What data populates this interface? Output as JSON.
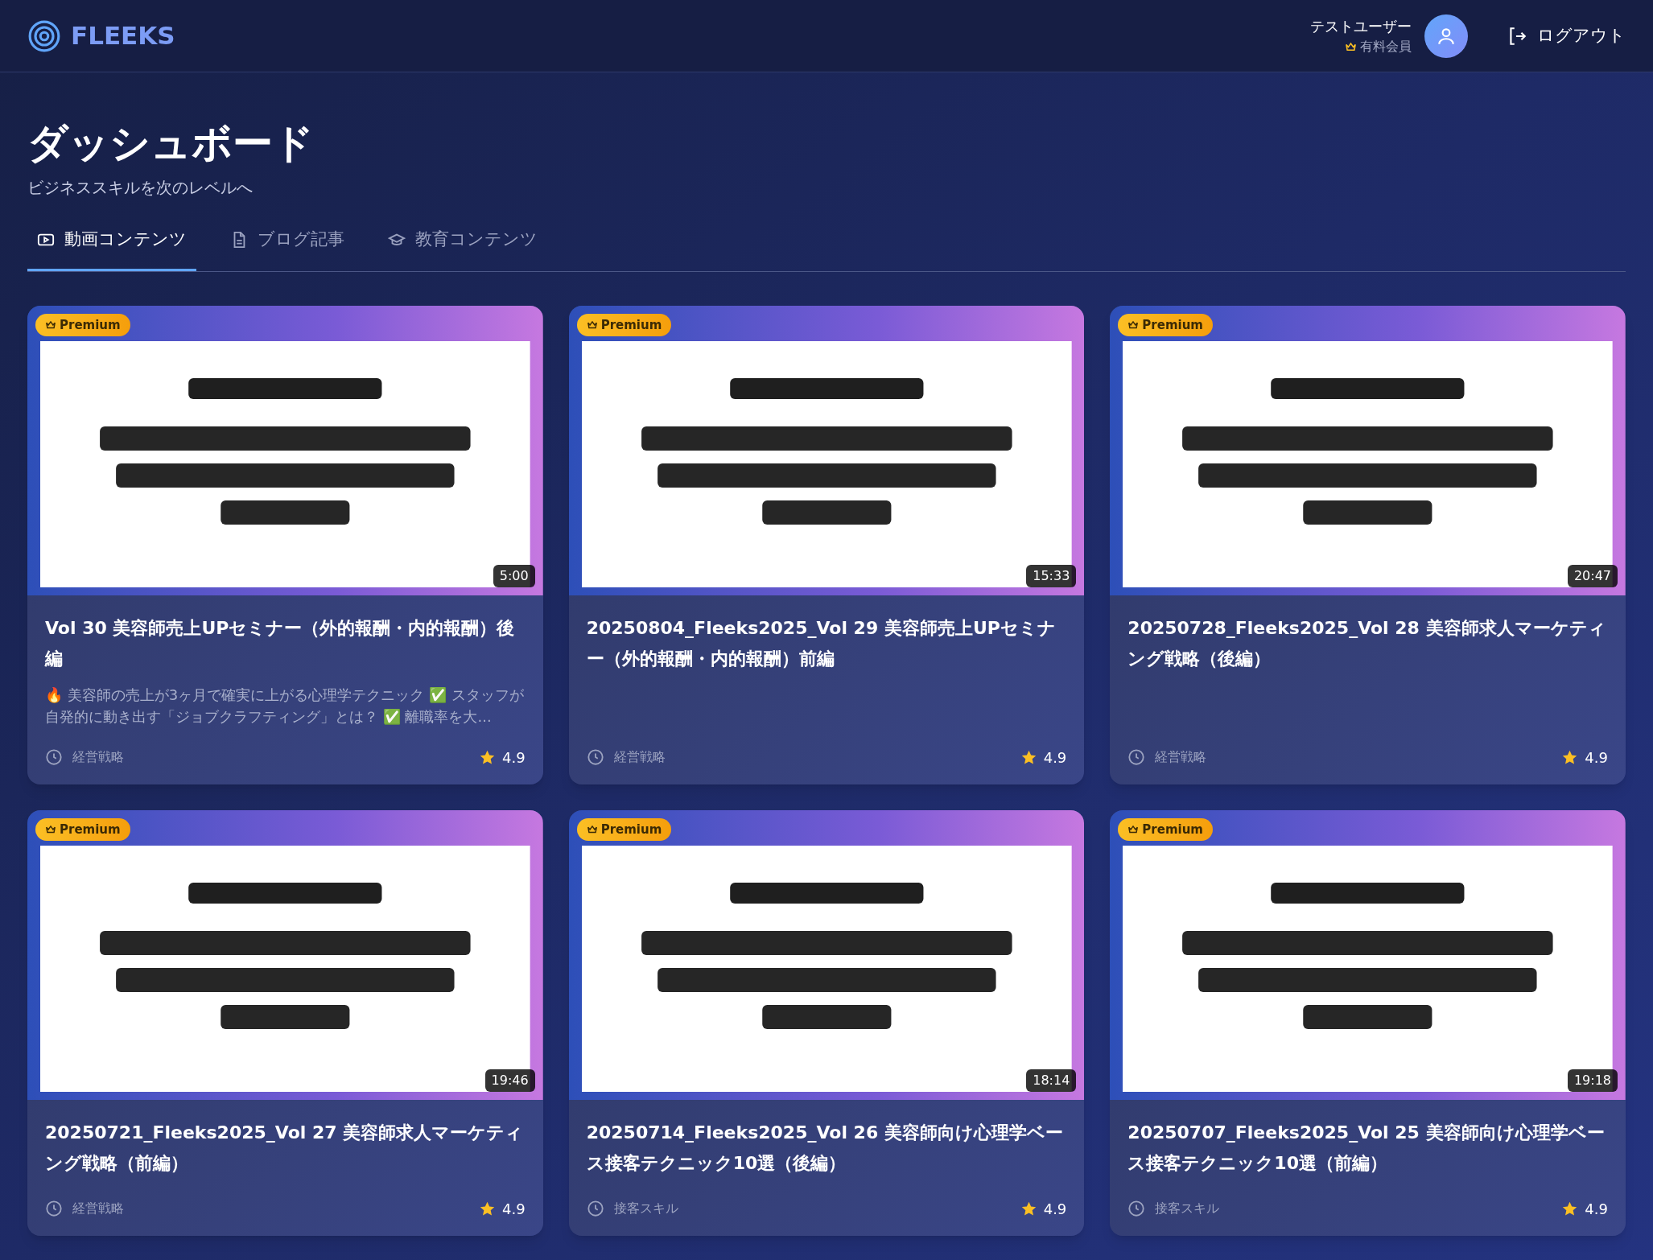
{
  "header": {
    "logo": "FLEEKS",
    "user": {
      "name": "テストユーザー",
      "membership": "有料会員"
    },
    "logout": "ログアウト"
  },
  "page": {
    "title": "ダッシュボード",
    "subtitle": "ビジネススキルを次のレベルへ"
  },
  "tabs": [
    {
      "label": "動画コンテンツ",
      "kind": "video",
      "selected": true
    },
    {
      "label": "ブログ記事",
      "kind": "blog",
      "selected": false
    },
    {
      "label": "教育コンテンツ",
      "kind": "education",
      "selected": false
    }
  ],
  "videos": [
    {
      "badge": "Premium",
      "duration": "5:00",
      "title": "Vol 30 美容師売上UPセミナー（外的報酬・内的報酬）後編",
      "description": "🔥 美容師の売上が3ヶ月で確実に上がる心理学テクニック ✅ スタッフが自発的に動き出す「ジョブクラフティング」とは？ ✅ 離職率を大...",
      "category": "経営戦略",
      "rating": "4.9"
    },
    {
      "badge": "Premium",
      "duration": "15:33",
      "title": "20250804_Fleeks2025_Vol 29 美容師売上UPセミナー（外的報酬・内的報酬）前編",
      "category": "経営戦略",
      "rating": "4.9"
    },
    {
      "badge": "Premium",
      "duration": "20:47",
      "title": "20250728_Fleeks2025_Vol 28 美容師求人マーケティング戦略（後編）",
      "category": "経営戦略",
      "rating": "4.9"
    },
    {
      "badge": "Premium",
      "duration": "19:46",
      "title": "20250721_Fleeks2025_Vol 27 美容師求人マーケティング戦略（前編）",
      "category": "経営戦略",
      "rating": "4.9"
    },
    {
      "badge": "Premium",
      "duration": "18:14",
      "title": "20250714_Fleeks2025_Vol 26 美容師向け心理学ベース接客テクニック10選（後編）",
      "category": "接客スキル",
      "rating": "4.9"
    },
    {
      "badge": "Premium",
      "duration": "19:18",
      "title": "20250707_Fleeks2025_Vol 25 美容師向け心理学ベース接客テクニック10選（前編）",
      "category": "接客スキル",
      "rating": "4.9"
    }
  ]
}
